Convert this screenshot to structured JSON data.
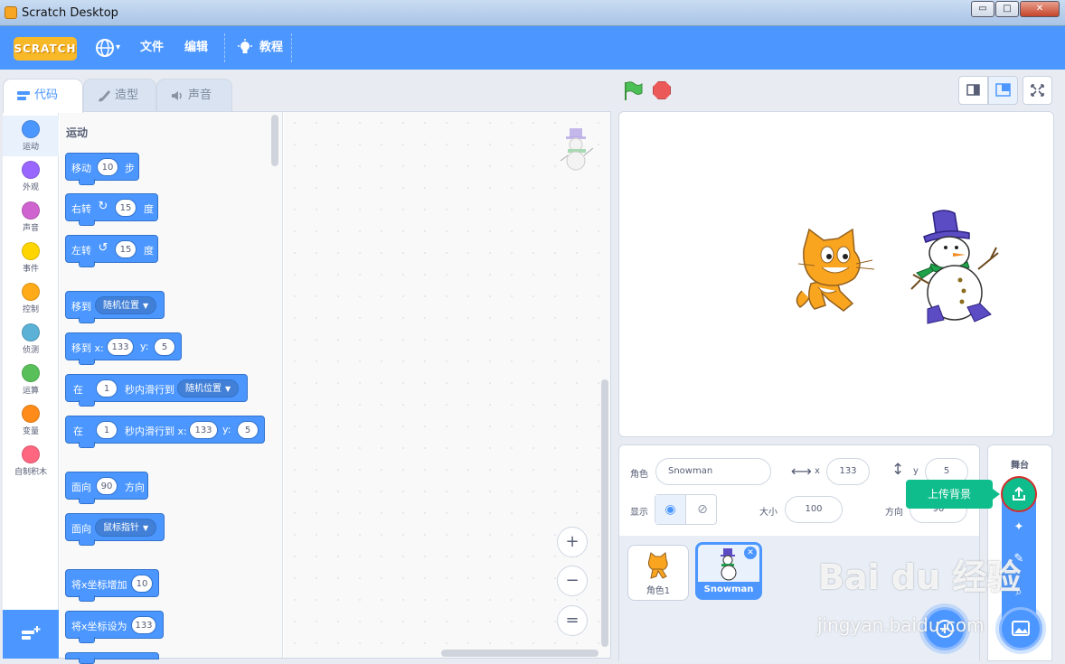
{
  "window": {
    "title": "Scratch Desktop",
    "minimize": "▭",
    "maximize": "□",
    "close": "✕"
  },
  "menubar": {
    "logo": "SCRATCH",
    "file": "文件",
    "edit": "编辑",
    "tutorials": "教程",
    "language_caret": "▾"
  },
  "tabs": [
    {
      "label": "代码",
      "active": true
    },
    {
      "label": "造型",
      "active": false
    },
    {
      "label": "声音",
      "active": false
    }
  ],
  "categories": [
    {
      "label": "运动",
      "color": "#4c97ff"
    },
    {
      "label": "外观",
      "color": "#9966ff"
    },
    {
      "label": "声音",
      "color": "#cf63cf"
    },
    {
      "label": "事件",
      "color": "#ffd500"
    },
    {
      "label": "控制",
      "color": "#ffab19"
    },
    {
      "label": "侦测",
      "color": "#5cb1d6"
    },
    {
      "label": "运算",
      "color": "#59c059"
    },
    {
      "label": "变量",
      "color": "#ff8c1a"
    },
    {
      "label": "自制积木",
      "color": "#ff6680"
    }
  ],
  "palette": {
    "title": "运动",
    "blocks": {
      "move": {
        "a": "移动",
        "v": "10",
        "b": "步"
      },
      "turn_right": {
        "a": "右转",
        "v": "15",
        "b": "度"
      },
      "turn_left": {
        "a": "左转",
        "v": "15",
        "b": "度"
      },
      "goto": {
        "a": "移到",
        "dd": "随机位置"
      },
      "goto_xy": {
        "a": "移到 x:",
        "x": "133",
        "ylab": "y:",
        "y": "5"
      },
      "glide": {
        "a": "在",
        "v": "1",
        "b": "秒内滑行到",
        "dd": "随机位置"
      },
      "glide_xy": {
        "a": "在",
        "v": "1",
        "b": "秒内滑行到 x:",
        "x": "133",
        "ylab": "y:",
        "y": "5"
      },
      "point_dir": {
        "a": "面向",
        "v": "90",
        "b": "方向"
      },
      "point_towards": {
        "a": "面向",
        "dd": "鼠标指针"
      },
      "change_x": {
        "a": "将x坐标增加",
        "v": "10"
      },
      "set_x": {
        "a": "将x坐标设为",
        "v": "133"
      }
    }
  },
  "zoom": {
    "in": "+",
    "out": "−",
    "reset": "="
  },
  "sprite_info": {
    "sprite_label": "角色",
    "sprite_name": "Snowman",
    "x_label": "x",
    "x_value": "133",
    "y_label": "y",
    "y_value": "5",
    "show_label": "显示",
    "size_label": "大小",
    "size_value": "100",
    "direction_label": "方向",
    "direction_value": "90"
  },
  "sprites": [
    {
      "name": "角色1",
      "selected": false
    },
    {
      "name": "Snowman",
      "selected": true
    }
  ],
  "stage_pane": {
    "label": "舞台",
    "tooltip": "上传背景"
  },
  "watermark": {
    "main": "Bai du 经验",
    "sub": "jingyan.baidu.com"
  }
}
